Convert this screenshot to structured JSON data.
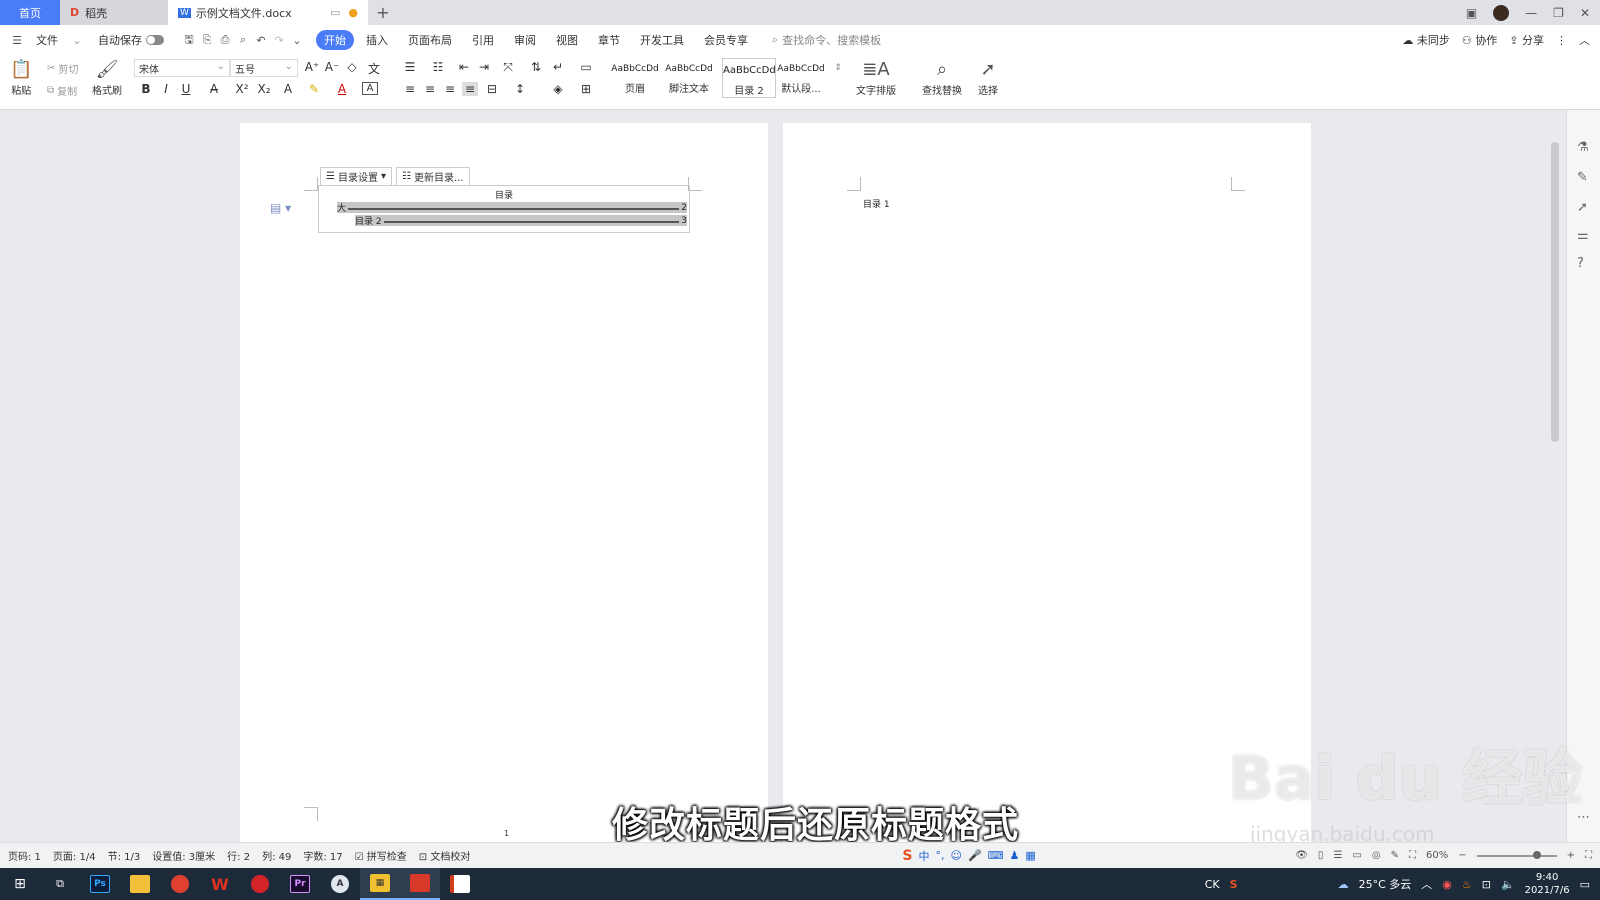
{
  "titlebar": {
    "tabs": [
      {
        "label": "首页"
      },
      {
        "label": "稻壳"
      },
      {
        "label": "示例文档文件.docx"
      }
    ],
    "add_tab": "+"
  },
  "menubar": {
    "file": "文件",
    "autosave": "自动保存",
    "tabs": [
      "开始",
      "插入",
      "页面布局",
      "引用",
      "审阅",
      "视图",
      "章节",
      "开发工具",
      "会员专享"
    ],
    "active_tab": "开始",
    "search_placeholder": "查找命令、搜索模板",
    "right": {
      "sync": "未同步",
      "collab": "协作",
      "share": "分享"
    }
  },
  "ribbon": {
    "paste": "粘贴",
    "cut": "剪切",
    "copy": "复制",
    "format_painter": "格式刷",
    "font_name": "宋体",
    "font_size": "五号",
    "styles": [
      {
        "sample": "AaBbCcDd",
        "name": "页眉"
      },
      {
        "sample": "AaBbCcDd",
        "name": "脚注文本"
      },
      {
        "sample": "AaBbCcDd",
        "name": "目录 2"
      },
      {
        "sample": "AaBbCcDd",
        "name": "默认段..."
      }
    ],
    "text_layout": "文字排版",
    "find_replace": "查找替换",
    "select": "选择"
  },
  "document": {
    "toc_settings": "目录设置",
    "toc_update": "更新目录...",
    "toc_title": "目录",
    "toc_entries": [
      {
        "label": "大",
        "page": "2"
      },
      {
        "label": "目录 2",
        "page": "3"
      }
    ],
    "page_number": "1",
    "right_page_heading": "目录 1"
  },
  "overlay": {
    "subtitle": "修改标题后还原标题格式",
    "watermark": "Bai du 经验",
    "watermark_url": "jingyan.baidu.com"
  },
  "statusbar": {
    "page_code": "页码: 1",
    "pages": "页面: 1/4",
    "section": "节: 1/3",
    "setting": "设置值: 3厘米",
    "row": "行: 2",
    "col": "列: 49",
    "word_count": "字数: 17",
    "spell_check": "拼写检查",
    "doc_proof": "文档校对",
    "ime_lang": "中",
    "zoom": "60%"
  },
  "taskbar": {
    "apps": [
      "Ps",
      "Pr"
    ],
    "tray_lang": "CK",
    "weather": "25°C 多云",
    "time": "9:40",
    "date": "2021/7/6"
  }
}
